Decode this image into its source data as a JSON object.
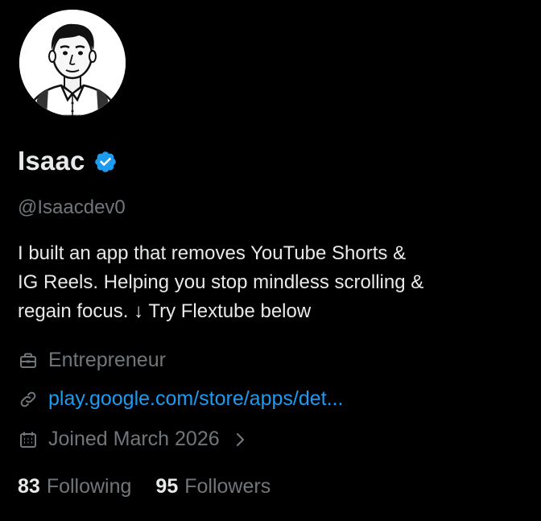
{
  "profile": {
    "display_name": "Isaac",
    "handle": "@Isaacdev0",
    "verified": true,
    "bio": "I built an app that removes YouTube Shorts &\nIG Reels. Helping you stop mindless scrolling &\nregain focus. ↓ Try Flextube below",
    "profession": "Entrepreneur",
    "website": "play.google.com/store/apps/det...",
    "joined": "Joined March 2026"
  },
  "stats": {
    "following_count": "83",
    "following_label": "Following",
    "followers_count": "95",
    "followers_label": "Followers"
  },
  "icons": {
    "verified": "verified-badge-icon",
    "profession": "briefcase-icon",
    "website": "link-icon",
    "joined": "calendar-icon",
    "joined_more": "chevron-right-icon"
  },
  "colors": {
    "background": "#000000",
    "primary_text": "#e7e9ea",
    "secondary_text": "#71767b",
    "link": "#1d9bf0",
    "verified": "#1d9bf0"
  }
}
